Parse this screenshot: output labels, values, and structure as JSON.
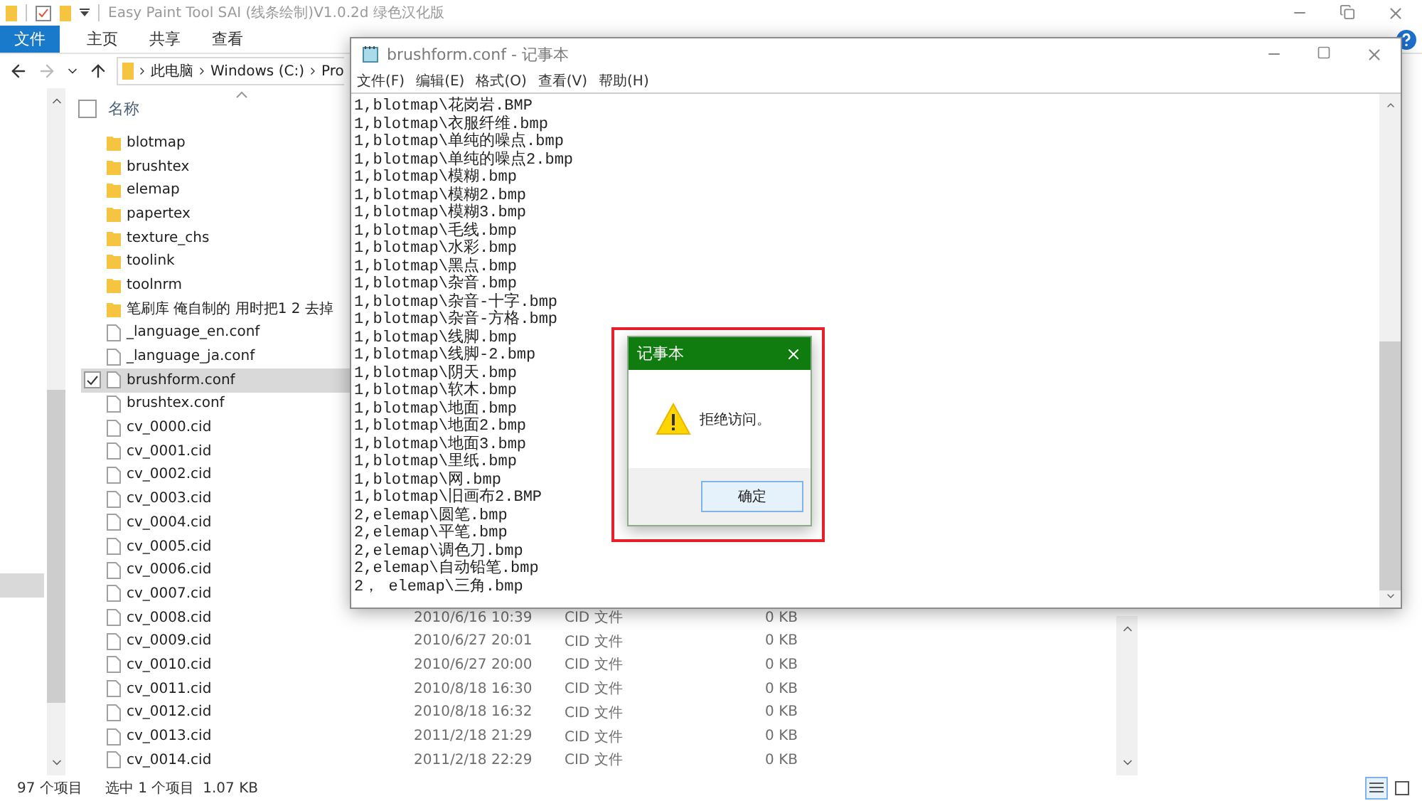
{
  "explorer": {
    "title": "Easy Paint Tool SAI (线条绘制)V1.0.2d 绿色汉化版",
    "ribbon_tabs": [
      {
        "label": "文件",
        "selected": true
      },
      {
        "label": "主页",
        "selected": false
      },
      {
        "label": "共享",
        "selected": false
      },
      {
        "label": "查看",
        "selected": false
      }
    ],
    "breadcrumbs": [
      "此电脑",
      "Windows (C:)",
      "Pro"
    ],
    "column_header": "名称",
    "select_all_checked": false,
    "files": [
      {
        "name": "blotmap",
        "kind": "folder",
        "selected": false
      },
      {
        "name": "brushtex",
        "kind": "folder",
        "selected": false
      },
      {
        "name": "elemap",
        "kind": "folder",
        "selected": false
      },
      {
        "name": "papertex",
        "kind": "folder",
        "selected": false
      },
      {
        "name": "texture_chs",
        "kind": "folder",
        "selected": false
      },
      {
        "name": "toolink",
        "kind": "folder",
        "selected": false
      },
      {
        "name": "toolnrm",
        "kind": "folder",
        "selected": false
      },
      {
        "name": "笔刷库 俺自制的 用时把1 2 去掉",
        "kind": "folder",
        "selected": false
      },
      {
        "name": "_language_en.conf",
        "kind": "file",
        "selected": false
      },
      {
        "name": "_language_ja.conf",
        "kind": "file",
        "selected": false
      },
      {
        "name": "brushform.conf",
        "kind": "file",
        "selected": true
      },
      {
        "name": "brushtex.conf",
        "kind": "file",
        "selected": false
      },
      {
        "name": "cv_0000.cid",
        "kind": "file",
        "selected": false
      },
      {
        "name": "cv_0001.cid",
        "kind": "file",
        "selected": false
      },
      {
        "name": "cv_0002.cid",
        "kind": "file",
        "selected": false
      },
      {
        "name": "cv_0003.cid",
        "kind": "file",
        "selected": false
      },
      {
        "name": "cv_0004.cid",
        "kind": "file",
        "selected": false
      },
      {
        "name": "cv_0005.cid",
        "kind": "file",
        "selected": false
      },
      {
        "name": "cv_0006.cid",
        "kind": "file",
        "selected": false
      },
      {
        "name": "cv_0007.cid",
        "kind": "file",
        "selected": false
      },
      {
        "name": "cv_0008.cid",
        "kind": "file",
        "selected": false,
        "modified": "2010/6/16 10:39",
        "type": "CID 文件",
        "size": "0 KB"
      },
      {
        "name": "cv_0009.cid",
        "kind": "file",
        "selected": false,
        "modified": "2010/6/27 20:01",
        "type": "CID 文件",
        "size": "0 KB"
      },
      {
        "name": "cv_0010.cid",
        "kind": "file",
        "selected": false,
        "modified": "2010/6/27 20:00",
        "type": "CID 文件",
        "size": "0 KB"
      },
      {
        "name": "cv_0011.cid",
        "kind": "file",
        "selected": false,
        "modified": "2010/8/18 16:30",
        "type": "CID 文件",
        "size": "0 KB"
      },
      {
        "name": "cv_0012.cid",
        "kind": "file",
        "selected": false,
        "modified": "2010/8/18 16:32",
        "type": "CID 文件",
        "size": "0 KB"
      },
      {
        "name": "cv_0013.cid",
        "kind": "file",
        "selected": false,
        "modified": "2011/2/18 21:29",
        "type": "CID 文件",
        "size": "0 KB"
      },
      {
        "name": "cv_0014.cid",
        "kind": "file",
        "selected": false,
        "modified": "2011/2/18 22:29",
        "type": "CID 文件",
        "size": "0 KB"
      }
    ],
    "status_bar": {
      "count": "97 个项目",
      "selection": "选中 1 个项目",
      "selection_size": "1.07 KB"
    }
  },
  "notepad": {
    "title": "brushform.conf - 记事本",
    "menu": [
      "文件(F)",
      "编辑(E)",
      "格式(O)",
      "查看(V)",
      "帮助(H)"
    ],
    "lines": [
      "1,blotmap\\花岗岩.BMP",
      "1,blotmap\\衣服纤维.bmp",
      "1,blotmap\\单纯的噪点.bmp",
      "1,blotmap\\单纯的噪点2.bmp",
      "1,blotmap\\模糊.bmp",
      "1,blotmap\\模糊2.bmp",
      "1,blotmap\\模糊3.bmp",
      "1,blotmap\\毛线.bmp",
      "1,blotmap\\水彩.bmp",
      "1,blotmap\\黑点.bmp",
      "1,blotmap\\杂音.bmp",
      "1,blotmap\\杂音-十字.bmp",
      "1,blotmap\\杂音-方格.bmp",
      "1,blotmap\\线脚.bmp",
      "1,blotmap\\线脚-2.bmp",
      "1,blotmap\\阴天.bmp",
      "1,blotmap\\软木.bmp",
      "1,blotmap\\地面.bmp",
      "1,blotmap\\地面2.bmp",
      "1,blotmap\\地面3.bmp",
      "1,blotmap\\里纸.bmp",
      "1,blotmap\\网.bmp",
      "1,blotmap\\旧画布2.BMP",
      "2,elemap\\圆笔.bmp",
      "2,elemap\\平笔.bmp",
      "2,elemap\\调色刀.bmp",
      "2,elemap\\自动铅笔.bmp",
      "2， elemap\\三角.bmp"
    ]
  },
  "dialog": {
    "title": "记事本",
    "message": "拒绝访问。",
    "button": "确定"
  }
}
